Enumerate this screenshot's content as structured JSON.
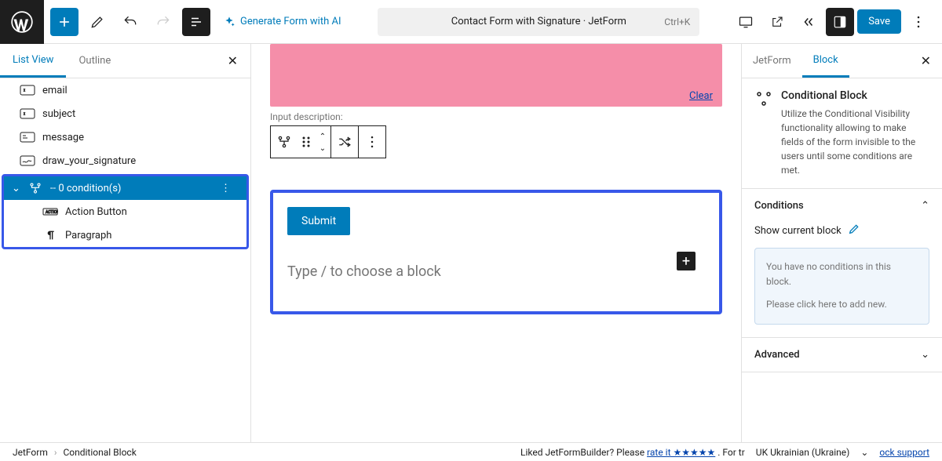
{
  "topbar": {
    "ai_button": "Generate Form with AI",
    "title": "Contact Form with Signature · JetForm",
    "shortcut": "Ctrl+K",
    "save": "Save"
  },
  "list_panel": {
    "tabs": {
      "list_view": "List View",
      "outline": "Outline"
    },
    "items": {
      "email": "email",
      "subject": "subject",
      "message": "message",
      "signature": "draw_your_signature",
      "condition": "-- 0 condition(s)",
      "action_button": "Action Button",
      "paragraph": "Paragraph"
    }
  },
  "canvas": {
    "clear": "Clear",
    "input_desc": "Input description:",
    "submit": "Submit",
    "placeholder": "Type / to choose a block"
  },
  "sidebar": {
    "tabs": {
      "jetform": "JetForm",
      "block": "Block"
    },
    "block_title": "Conditional Block",
    "block_desc": "Utilize the Conditional Visibility functionality allowing to make fields of the form invisible to the users until some conditions are met.",
    "conditions": "Conditions",
    "show_block": "Show current block",
    "hint_line1": "You have no conditions in this block.",
    "hint_line2": "Please click here to add new.",
    "advanced": "Advanced"
  },
  "footer": {
    "bc1": "JetForm",
    "bc2": "Conditional Block",
    "liked": "Liked JetFormBuilder? Please ",
    "rate": "rate it ★★★★★",
    "for": ". For tr",
    "lang": "UK Ukrainian (Ukraine)",
    "support": "ock support"
  }
}
